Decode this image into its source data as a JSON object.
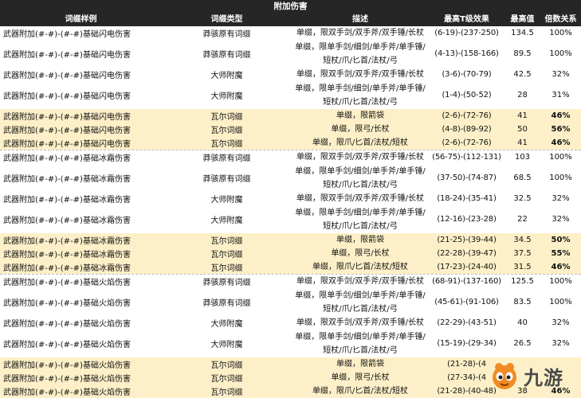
{
  "title": "附加伤害",
  "headers": [
    "词缀样例",
    "词缀类型",
    "描述",
    "最高T级效果",
    "最高值",
    "倍数关系"
  ],
  "rows": [
    {
      "name": "武器附加(#-#)-(#-#)基础闪电伤害",
      "type": "莽骇原有词缀",
      "desc": "单缀，限双手剑/双手斧/双手锤/长杖",
      "range": "(6-19)-(237-250)",
      "max": "134.5",
      "ratio": "100%",
      "hl": false,
      "bold": false,
      "tall": false,
      "top": false
    },
    {
      "name": "武器附加(#-#)-(#-#)基础闪电伤害",
      "type": "莽骇原有词缀",
      "desc": "单缀，限单手剑/细剑/单手斧/单手锤/短杖/爪/匕首/法杖/弓",
      "range": "(4-13)-(158-166)",
      "max": "89.5",
      "ratio": "100%",
      "hl": false,
      "bold": false,
      "tall": true,
      "top": false
    },
    {
      "name": "武器附加(#-#)-(#-#)基础闪电伤害",
      "type": "大师附魔",
      "desc": "单缀，限双手剑/双手斧/双手锤/长杖",
      "range": "(3-6)-(70-79)",
      "max": "42.5",
      "ratio": "32%",
      "hl": false,
      "bold": false,
      "tall": false,
      "top": false
    },
    {
      "name": "武器附加(#-#)-(#-#)基础闪电伤害",
      "type": "大师附魔",
      "desc": "单缀，限单手剑/细剑/单手斧/单手锤/短杖/爪/匕首/法杖/弓",
      "range": "(1-4)-(50-52)",
      "max": "28",
      "ratio": "31%",
      "hl": false,
      "bold": false,
      "tall": true,
      "top": false
    },
    {
      "name": "武器附加(#-#)-(#-#)基础闪电伤害",
      "type": "瓦尔词缀",
      "desc": "单缀，限箭袋",
      "range": "(2-6)-(72-76)",
      "max": "41",
      "ratio": "46%",
      "hl": true,
      "bold": true,
      "tall": false,
      "top": false
    },
    {
      "name": "武器附加(#-#)-(#-#)基础闪电伤害",
      "type": "瓦尔词缀",
      "desc": "单缀，限弓/长杖",
      "range": "(4-8)-(89-92)",
      "max": "50",
      "ratio": "56%",
      "hl": true,
      "bold": true,
      "tall": false,
      "top": false
    },
    {
      "name": "武器附加(#-#)-(#-#)基础闪电伤害",
      "type": "瓦尔词缀",
      "desc": "单缀，限爪/匕首/法杖/短杖",
      "range": "(2-6)-(72-76)",
      "max": "41",
      "ratio": "46%",
      "hl": true,
      "bold": true,
      "tall": false,
      "top": false
    },
    {
      "name": "武器附加(#-#)-(#-#)基础冰霜伤害",
      "type": "莽骇原有词缀",
      "desc": "单缀，限双手剑/双手斧/双手锤/长杖",
      "range": "(56-75)-(112-131)",
      "max": "103",
      "ratio": "100%",
      "hl": false,
      "bold": false,
      "tall": false,
      "top": true
    },
    {
      "name": "武器附加(#-#)-(#-#)基础冰霜伤害",
      "type": "莽骇原有词缀",
      "desc": "单缀，限单手剑/细剑/单手斧/单手锤/短杖/爪/匕首/法杖/弓",
      "range": "(37-50)-(74-87)",
      "max": "68.5",
      "ratio": "100%",
      "hl": false,
      "bold": false,
      "tall": true,
      "top": false
    },
    {
      "name": "武器附加(#-#)-(#-#)基础冰霜伤害",
      "type": "大师附魔",
      "desc": "单缀，限双手剑/双手斧/双手锤/长杖",
      "range": "(18-24)-(35-41)",
      "max": "32.5",
      "ratio": "32%",
      "hl": false,
      "bold": false,
      "tall": false,
      "top": false
    },
    {
      "name": "武器附加(#-#)-(#-#)基础冰霜伤害",
      "type": "大师附魔",
      "desc": "单缀，限单手剑/细剑/单手斧/单手锤/短杖/爪/匕首/法杖/弓",
      "range": "(12-16)-(23-28)",
      "max": "22",
      "ratio": "32%",
      "hl": false,
      "bold": false,
      "tall": true,
      "top": false
    },
    {
      "name": "武器附加(#-#)-(#-#)基础冰霜伤害",
      "type": "瓦尔词缀",
      "desc": "单缀，限箭袋",
      "range": "(21-25)-(39-44)",
      "max": "34.5",
      "ratio": "50%",
      "hl": true,
      "bold": true,
      "tall": false,
      "top": false
    },
    {
      "name": "武器附加(#-#)-(#-#)基础冰霜伤害",
      "type": "瓦尔词缀",
      "desc": "单缀，限弓/长杖",
      "range": "(22-28)-(39-47)",
      "max": "37.5",
      "ratio": "55%",
      "hl": true,
      "bold": true,
      "tall": false,
      "top": false
    },
    {
      "name": "武器附加(#-#)-(#-#)基础冰霜伤害",
      "type": "瓦尔词缀",
      "desc": "单缀，限爪/匕首/法杖/短杖",
      "range": "(17-23)-(24-40)",
      "max": "31.5",
      "ratio": "46%",
      "hl": true,
      "bold": true,
      "tall": false,
      "top": false
    },
    {
      "name": "武器附加(#-#)-(#-#)基础火焰伤害",
      "type": "莽骇原有词缀",
      "desc": "单缀，限双手剑/双手斧/双手锤/长杖",
      "range": "(68-91)-(137-160)",
      "max": "125.5",
      "ratio": "100%",
      "hl": false,
      "bold": false,
      "tall": false,
      "top": true
    },
    {
      "name": "武器附加(#-#)-(#-#)基础火焰伤害",
      "type": "莽骇原有词缀",
      "desc": "单缀，限单手剑/细剑/单手斧/单手锤/短杖/爪/匕首/法杖/弓",
      "range": "(45-61)-(91-106)",
      "max": "83.5",
      "ratio": "100%",
      "hl": false,
      "bold": false,
      "tall": true,
      "top": false
    },
    {
      "name": "武器附加(#-#)-(#-#)基础火焰伤害",
      "type": "大师附魔",
      "desc": "单缀，限双手剑/双手斧/双手锤/长杖",
      "range": "(22-29)-(43-51)",
      "max": "40",
      "ratio": "32%",
      "hl": false,
      "bold": false,
      "tall": false,
      "top": false
    },
    {
      "name": "武器附加(#-#)-(#-#)基础火焰伤害",
      "type": "大师附魔",
      "desc": "单缀，限单手剑/细剑/单手斧/单手锤/短杖/爪/匕首/法杖/弓",
      "range": "(15-19)-(29-34)",
      "max": "26.5",
      "ratio": "32%",
      "hl": false,
      "bold": false,
      "tall": true,
      "top": false
    },
    {
      "name": "武器附加(#-#)-(#-#)基础火焰伤害",
      "type": "瓦尔词缀",
      "desc": "单缀，限箭袋",
      "range": "(21-28)-(4",
      "max": "",
      "ratio": "",
      "hl": true,
      "bold": true,
      "tall": false,
      "top": false
    },
    {
      "name": "武器附加(#-#)-(#-#)基础火焰伤害",
      "type": "瓦尔词缀",
      "desc": "单缀，限弓/长杖",
      "range": "(27-34)-(4",
      "max": "",
      "ratio": "",
      "hl": true,
      "bold": true,
      "tall": false,
      "top": false
    },
    {
      "name": "武器附加(#-#)-(#-#)基础火焰伤害",
      "type": "瓦尔词缀",
      "desc": "单缀，限爪/匕首/法杖/短杖",
      "range": "(21-28)-(40-48)",
      "max": "38",
      "ratio": "46%",
      "hl": true,
      "bold": true,
      "tall": false,
      "top": false
    }
  ],
  "watermark": {
    "text": "九游",
    "icon": "mascot-logo-icon"
  }
}
